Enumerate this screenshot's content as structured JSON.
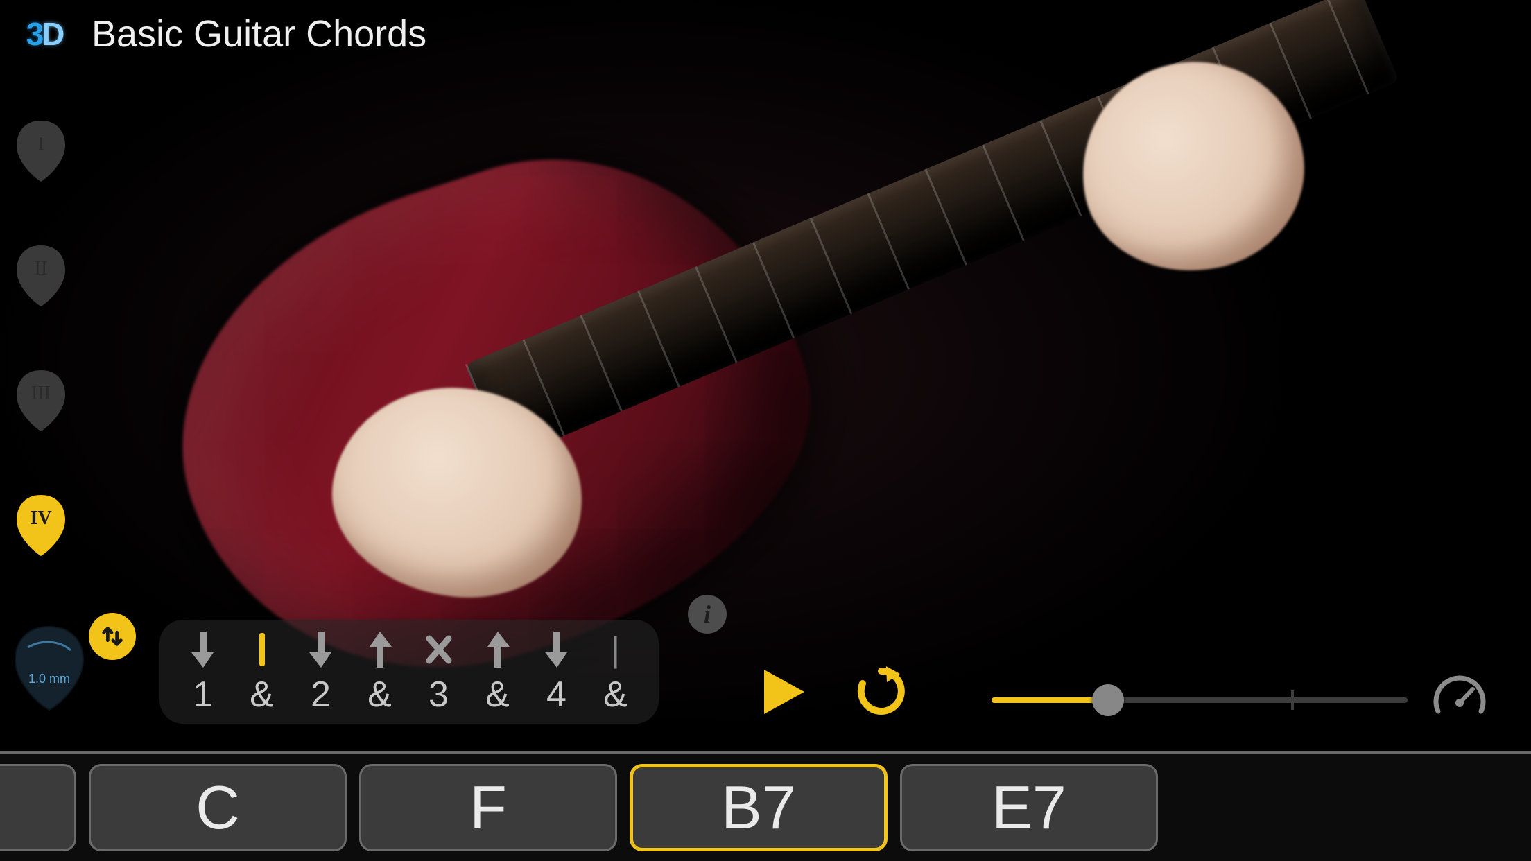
{
  "header": {
    "logo_left": "3",
    "logo_right": "D",
    "title": "Basic Guitar Chords"
  },
  "view_tabs": {
    "items": [
      {
        "label": "I",
        "active": false
      },
      {
        "label": "II",
        "active": false
      },
      {
        "label": "III",
        "active": false
      },
      {
        "label": "IV",
        "active": true
      }
    ]
  },
  "plectrum": {
    "thickness": "1.0 mm"
  },
  "order_toggle": {
    "icon": "swap-vertical-icon"
  },
  "strum": {
    "beats": [
      {
        "symbol": "down",
        "label": "1",
        "accent": false
      },
      {
        "symbol": "bar",
        "label": "&",
        "accent": true
      },
      {
        "symbol": "down",
        "label": "2",
        "accent": false
      },
      {
        "symbol": "up",
        "label": "&",
        "accent": false
      },
      {
        "symbol": "mute",
        "label": "3",
        "accent": false
      },
      {
        "symbol": "up",
        "label": "&",
        "accent": false
      },
      {
        "symbol": "down",
        "label": "4",
        "accent": false
      },
      {
        "symbol": "rest",
        "label": "&",
        "accent": false
      }
    ]
  },
  "info_button": {
    "label": "i"
  },
  "playback": {
    "play_icon": "play-icon",
    "loop_icon": "loop-icon"
  },
  "tempo": {
    "value_pct": 28,
    "tick_pct": 72
  },
  "speedometer": {
    "icon": "speedometer-icon"
  },
  "chords": {
    "items": [
      {
        "label": "",
        "selected": false,
        "partial": true
      },
      {
        "label": "C",
        "selected": false,
        "partial": false
      },
      {
        "label": "F",
        "selected": false,
        "partial": false
      },
      {
        "label": "B7",
        "selected": true,
        "partial": false
      },
      {
        "label": "E7",
        "selected": false,
        "partial": false
      }
    ]
  }
}
